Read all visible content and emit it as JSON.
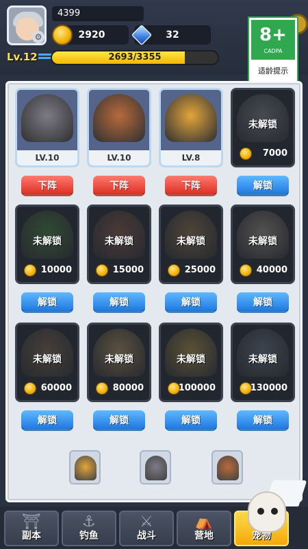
{
  "player": {
    "name": "4399",
    "coins": "2920",
    "gems": "32",
    "level": "Lv.12",
    "exp_text": "2693/3355",
    "exp_fraction": 0.8026
  },
  "age_rating": {
    "rating": "8+",
    "org": "CADPA",
    "note": "适龄提示"
  },
  "pets": [
    {
      "state": "owned",
      "level": "LV.10",
      "button": "下阵",
      "color": "#7d7a86"
    },
    {
      "state": "owned",
      "level": "LV.10",
      "button": "下阵",
      "color": "#b86a3a"
    },
    {
      "state": "owned",
      "level": "LV.8",
      "button": "下阵",
      "color": "#e3a53a"
    },
    {
      "state": "locked",
      "lock_text": "未解锁",
      "price": "7000",
      "button": "解锁",
      "color": "#8d8a94"
    },
    {
      "state": "locked",
      "lock_text": "未解锁",
      "price": "10000",
      "button": "解锁",
      "color": "#4a8a3a"
    },
    {
      "state": "locked",
      "lock_text": "未解锁",
      "price": "15000",
      "button": "解锁",
      "color": "#9a5a46"
    },
    {
      "state": "locked",
      "lock_text": "未解锁",
      "price": "25000",
      "button": "解锁",
      "color": "#a07a4a"
    },
    {
      "state": "locked",
      "lock_text": "未解锁",
      "price": "40000",
      "button": "解锁",
      "color": "#b0a090"
    },
    {
      "state": "locked",
      "lock_text": "未解锁",
      "price": "60000",
      "button": "解锁",
      "color": "#8a6a4a"
    },
    {
      "state": "locked",
      "lock_text": "未解锁",
      "price": "80000",
      "button": "解锁",
      "color": "#c8a060"
    },
    {
      "state": "locked",
      "lock_text": "未解锁",
      "price": "100000",
      "button": "解锁",
      "color": "#c8a040"
    },
    {
      "state": "locked",
      "lock_text": "未解锁",
      "price": "130000",
      "button": "解锁",
      "color": "#6a7a8a"
    }
  ],
  "team_slots": [
    {
      "color": "#e3a53a"
    },
    {
      "color": "#7d7a86"
    },
    {
      "color": "#b86a3a"
    }
  ],
  "nav": {
    "items": [
      {
        "label": "副本",
        "icon": "gate-icon",
        "glyph": "⛩"
      },
      {
        "label": "钓鱼",
        "icon": "fishing-hook-icon",
        "glyph": "⚓"
      },
      {
        "label": "战斗",
        "icon": "crossed-swords-icon",
        "glyph": "⚔"
      },
      {
        "label": "营地",
        "icon": "camp-icon",
        "glyph": "⛺"
      },
      {
        "label": "宠物",
        "icon": "pet-icon",
        "glyph": ""
      }
    ],
    "active_index": 4
  },
  "colors": {
    "accent_yellow": "#f3a90b",
    "unlock_blue": "#1f78e0",
    "unassign_red": "#de2f24"
  }
}
